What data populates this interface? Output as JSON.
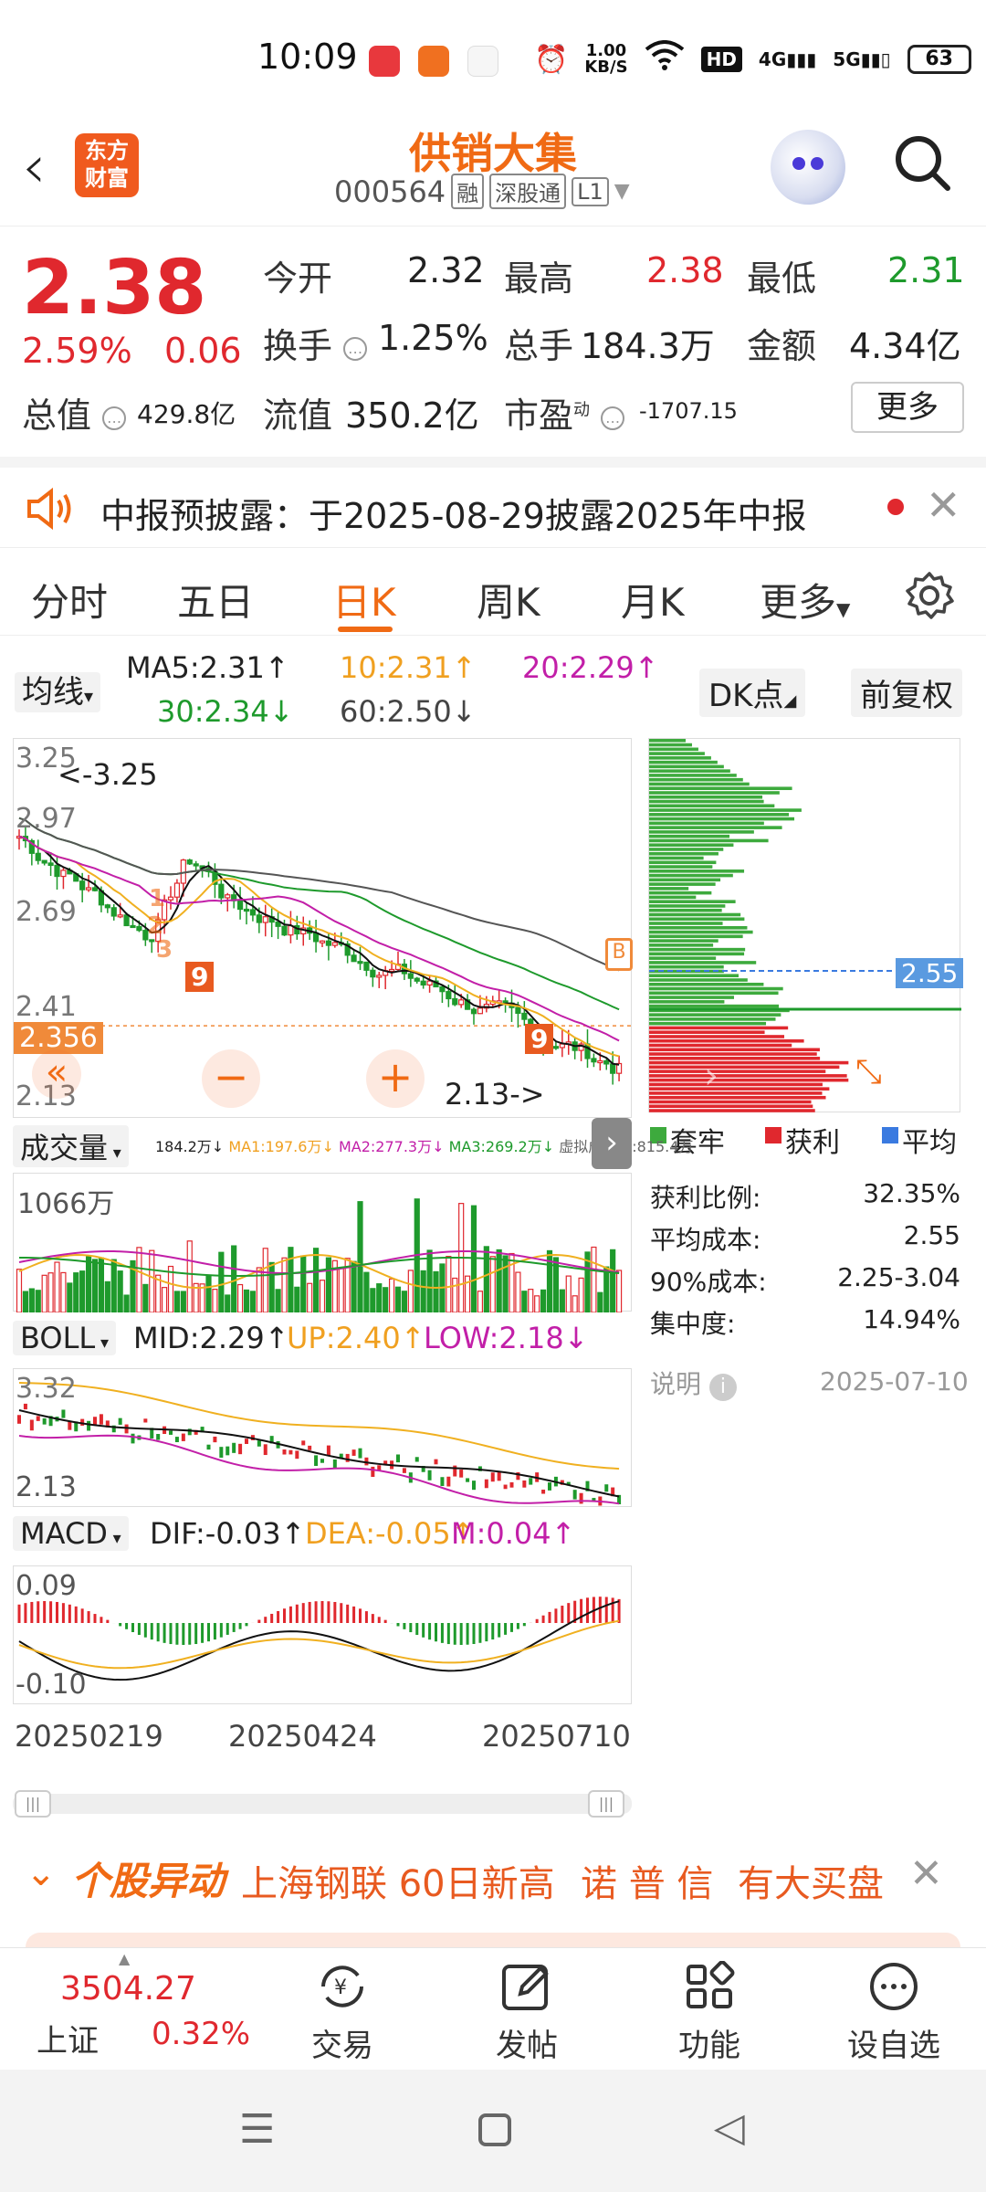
{
  "status": {
    "time": "10:09",
    "net_speed_top": "1.00",
    "net_speed_unit": "KB/S",
    "hd": "HD",
    "sig4g": "4G",
    "sig5g": "5G",
    "battery": "63"
  },
  "header": {
    "logo_line1": "东方",
    "logo_line2": "财富",
    "stock_name": "供销大集",
    "stock_code": "000564",
    "tags": [
      "融",
      "深股通",
      "L1"
    ]
  },
  "quote": {
    "price": "2.38",
    "pct": "2.59%",
    "change": "0.06",
    "open_label": "今开",
    "open": "2.32",
    "high_label": "最高",
    "high": "2.38",
    "low_label": "最低",
    "low": "2.31",
    "turnover_label": "换手",
    "turnover": "1.25%",
    "volume_label": "总手",
    "volume": "184.3万",
    "amount_label": "金额",
    "amount": "4.34亿",
    "mcap_label": "总值",
    "mcap": "429.8亿",
    "float_label": "流值",
    "float": "350.2亿",
    "pe_label": "市盈",
    "pe_sup": "动",
    "pe": "-1707.15",
    "more": "更多"
  },
  "notice": {
    "text": "中报预披露：于2025-08-29披露2025年中报"
  },
  "tabs": [
    {
      "label": "分时"
    },
    {
      "label": "五日"
    },
    {
      "label": "日K"
    },
    {
      "label": "周K"
    },
    {
      "label": "月K"
    },
    {
      "label": "更多"
    }
  ],
  "ma": {
    "select": "均线",
    "ma5": "MA5:2.31",
    "ma10": "10:2.31",
    "ma20": "20:2.29",
    "ma30": "30:2.34",
    "ma60": "60:2.50",
    "dk": "DK点",
    "fq": "前复权"
  },
  "kchart": {
    "y_top": "3.25",
    "y_mid1": "2.97",
    "y_mid2": "2.69",
    "y_low1": "2.41",
    "y_bottom": "2.13",
    "max_note": "<-3.25",
    "min_note": "2.13->",
    "current": "2.356",
    "nine_labels": [
      "1",
      "2",
      "3",
      "9",
      "9"
    ]
  },
  "volume": {
    "select": "成交量",
    "stats": "184.2万↓",
    "ma1": "MA1:197.6万↓",
    "ma2": "MA2:277.3万↓",
    "ma3": "MA3:269.2万↓",
    "virtual": "虚拟成交量:815.4万",
    "ymax": "1066万"
  },
  "boll": {
    "select": "BOLL",
    "mid": "MID:2.29",
    "up": "UP:2.40",
    "low": "LOW:2.18",
    "ytop": "3.32",
    "ybottom": "2.13"
  },
  "macd": {
    "select": "MACD",
    "dif": "DIF:-0.03",
    "dea": "DEA:-0.05",
    "m": "M:0.04",
    "ytop": "0.09",
    "ybottom": "-0.10"
  },
  "dates": [
    "20250219",
    "20250424",
    "20250710"
  ],
  "chips": {
    "avg_label": "2.55",
    "legend": [
      "套牢",
      "获利",
      "平均"
    ],
    "rows": [
      {
        "k": "获利比例:",
        "v": "32.35%"
      },
      {
        "k": "平均成本:",
        "v": "2.55"
      },
      {
        "k": "90%成本:",
        "v": "2.25-3.04"
      },
      {
        "k": "集中度:",
        "v": "14.94%"
      }
    ],
    "note": "说明",
    "date": "2025-07-10"
  },
  "movement": {
    "title": "个股异动",
    "items": [
      "上海钢联 60日新高",
      "诺 普 信",
      "有大买盘"
    ]
  },
  "bottom": {
    "index_value": "3504.27",
    "index_name": "上证",
    "index_pct": "0.32%",
    "trade": "交易",
    "post": "发帖",
    "func": "功能",
    "watch": "设自选"
  },
  "colors": {
    "up": "#e0282e",
    "down": "#1e9a2c",
    "accent": "#f06a14"
  }
}
